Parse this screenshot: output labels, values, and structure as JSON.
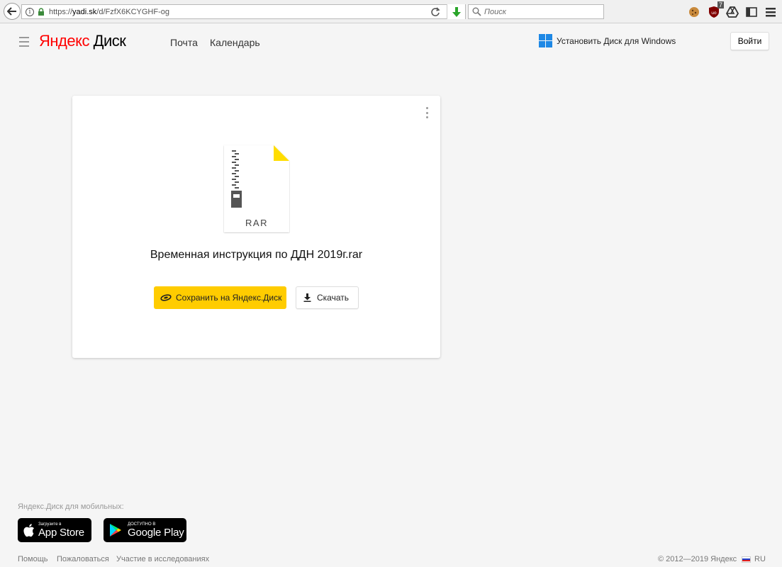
{
  "browser": {
    "url_prefix": "https://",
    "url_host": "yadi.sk",
    "url_path": "/d/FzfX6KCYGHF-og",
    "search_placeholder": "Поиск",
    "ext_badge": "7"
  },
  "header": {
    "logo_brand": "Яндекс",
    "logo_product": " Диск",
    "nav": [
      "Почта",
      "Календарь"
    ],
    "install_label": "Установить Диск для Windows",
    "login_label": "Войти"
  },
  "file": {
    "type_label": "RAR",
    "name": "Временная инструкция по ДДН 2019г.rar",
    "save_label": "Сохранить на Яндекс.Диск",
    "download_label": "Скачать"
  },
  "footer": {
    "mobile_label": "Яндекс.Диск для мобильных:",
    "appstore_small": "Загрузите в",
    "appstore_big": "App Store",
    "googleplay_small": "ДОСТУПНО В",
    "googleplay_big": "Google Play",
    "links": [
      "Помощь",
      "Пожаловаться",
      "Участие в исследованиях"
    ],
    "copyright": "© 2012—2019 Яндекс",
    "lang": "RU"
  },
  "colors": {
    "accent_yellow": "#ffcc00",
    "logo_red": "#ff0000",
    "windows_blue": "#1e88e5"
  }
}
